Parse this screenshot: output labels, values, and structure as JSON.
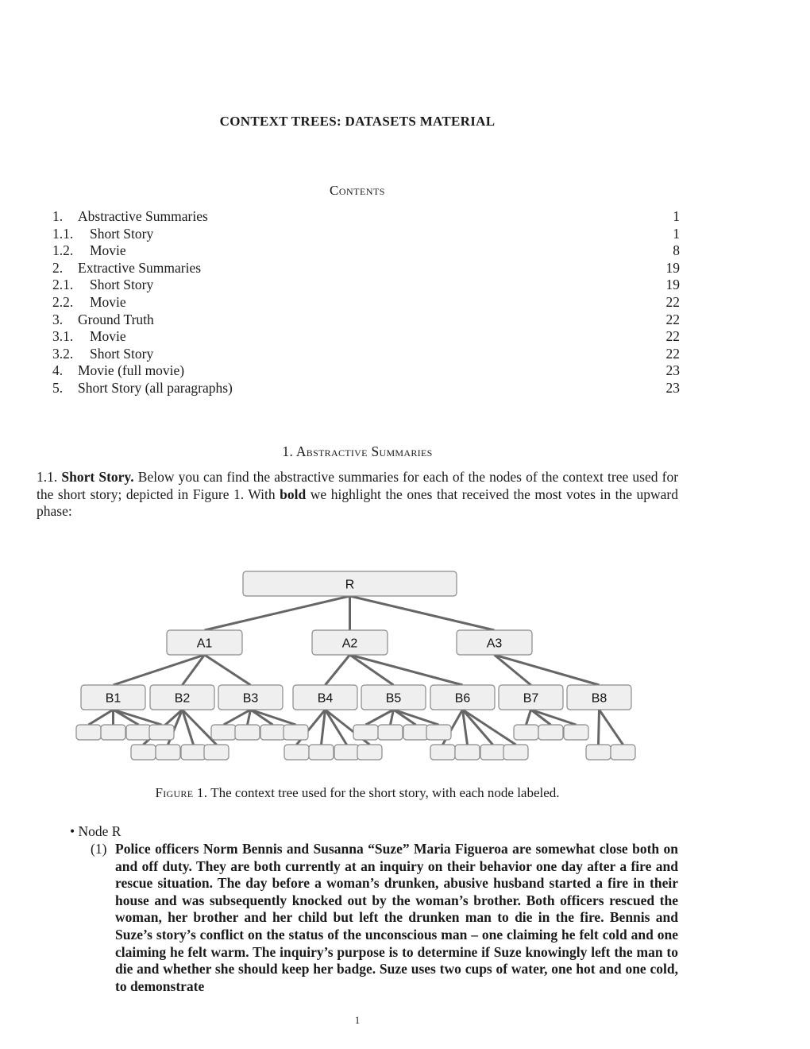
{
  "document": {
    "title": "CONTEXT TREES: DATASETS MATERIAL",
    "page_number": "1"
  },
  "contents": {
    "heading": "Contents",
    "entries": [
      {
        "num": "1.",
        "label": "Abstractive Summaries",
        "page": "1",
        "level": 1
      },
      {
        "num": "1.1.",
        "label": "Short Story",
        "page": "1",
        "level": 2
      },
      {
        "num": "1.2.",
        "label": "Movie",
        "page": "8",
        "level": 2
      },
      {
        "num": "2.",
        "label": "Extractive Summaries",
        "page": "19",
        "level": 1
      },
      {
        "num": "2.1.",
        "label": "Short Story",
        "page": "19",
        "level": 2
      },
      {
        "num": "2.2.",
        "label": "Movie",
        "page": "22",
        "level": 2
      },
      {
        "num": "3.",
        "label": "Ground Truth",
        "page": "22",
        "level": 1
      },
      {
        "num": "3.1.",
        "label": "Movie",
        "page": "22",
        "level": 2
      },
      {
        "num": "3.2.",
        "label": "Short Story",
        "page": "22",
        "level": 2
      },
      {
        "num": "4.",
        "label": "Movie (full movie)",
        "page": "23",
        "level": 1
      },
      {
        "num": "5.",
        "label": "Short Story (all paragraphs)",
        "page": "23",
        "level": 1
      }
    ]
  },
  "section": {
    "heading": "1. Abstractive Summaries",
    "subsection_num": "1.1.",
    "subsection_title": "Short Story.",
    "intro_part1": "Below you can find the abstractive summaries for each of the nodes of the context tree used for the short story; depicted in Figure 1. With",
    "intro_bold": "bold",
    "intro_part2": "we highlight the ones that received the most votes in the upward phase:"
  },
  "figure": {
    "caption_label": "Figure 1.",
    "caption_text": "The context tree used for the short story, with each node labeled.",
    "tree": {
      "root": "R",
      "level_a": [
        "A1",
        "A2",
        "A3"
      ],
      "level_b": [
        {
          "label": "B1",
          "parent": "A1",
          "leaves": 4
        },
        {
          "label": "B2",
          "parent": "A1",
          "leaves": 4
        },
        {
          "label": "B3",
          "parent": "A1",
          "leaves": 4
        },
        {
          "label": "B4",
          "parent": "A2",
          "leaves": 4
        },
        {
          "label": "B5",
          "parent": "A2",
          "leaves": 4
        },
        {
          "label": "B6",
          "parent": "A2",
          "leaves": 4
        },
        {
          "label": "B7",
          "parent": "A3",
          "leaves": 3
        },
        {
          "label": "B8",
          "parent": "A3",
          "leaves": 2
        }
      ]
    }
  },
  "nodes": [
    {
      "label": "Node R",
      "items": [
        {
          "num": "(1)",
          "text": "Police officers Norm Bennis and Susanna “Suze” Maria Figueroa are somewhat close both on and off duty. They are both currently at an inquiry on their behavior one day after a fire and rescue situation. The day before a woman’s drunken, abusive husband started a fire in their house and was subsequently knocked out by the woman’s brother. Both officers rescued the woman, her brother and her child but left the drunken man to die in the fire. Bennis and Suze’s story’s conflict on the status of the unconscious man – one claiming he felt cold and one claiming he felt warm. The inquiry’s purpose is to determine if Suze knowingly left the man to die and whether she should keep her badge. Suze uses two cups of water, one hot and one cold, to demonstrate",
          "bold": true
        }
      ]
    }
  ]
}
